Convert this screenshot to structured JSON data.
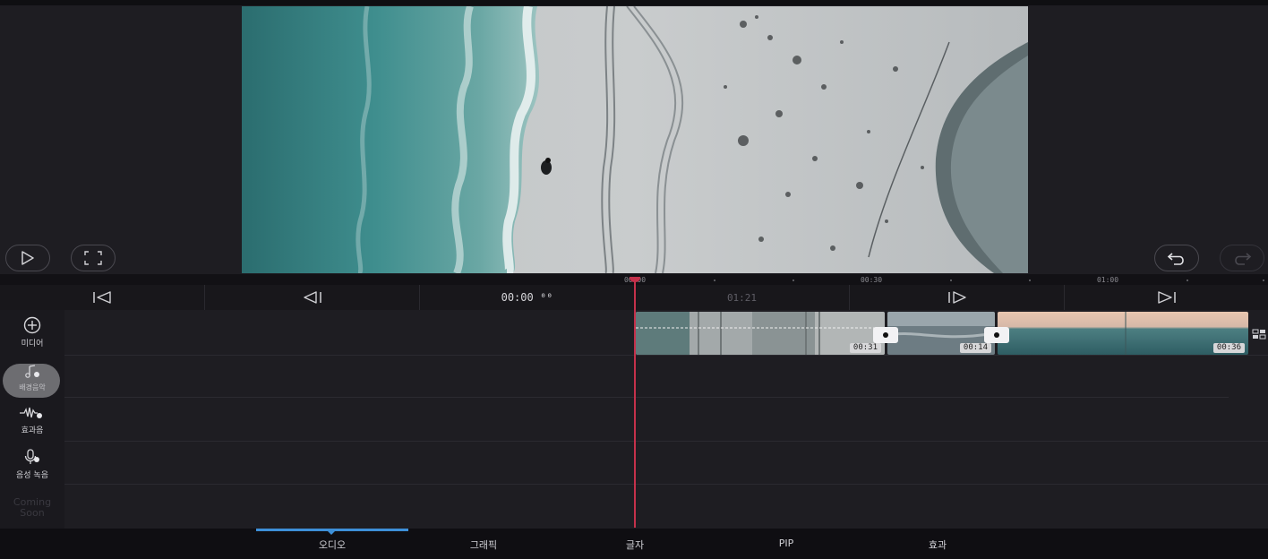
{
  "preview": {
    "play_icon": "play-icon",
    "fullscreen_icon": "fullscreen-icon",
    "undo_icon": "undo-icon",
    "redo_icon": "redo-icon"
  },
  "ruler": {
    "labels": [
      "00:00",
      "00:30",
      "01:00"
    ]
  },
  "transport": {
    "current_time": "00:00 ⁰⁰",
    "total_time": "01:21",
    "icons": [
      "skip-to-start-icon",
      "previous-frame-icon",
      "next-frame-icon",
      "skip-to-end-icon"
    ]
  },
  "sidebar": {
    "media": "미디어",
    "music": "배경음악",
    "sound_effect": "효과음",
    "voice_record": "음성 녹음",
    "coming_soon": "Coming Soon"
  },
  "clips": [
    {
      "duration": "00:31"
    },
    {
      "duration": "00:14"
    },
    {
      "duration": "00:36"
    }
  ],
  "tabs": {
    "audio": "오디오",
    "graphic": "그래픽",
    "text": "글자",
    "pip": "PIP",
    "effect": "효과"
  },
  "colors": {
    "playhead": "#c4314b",
    "tab_indicator": "#3d8fd8",
    "background": "#1e1d22"
  }
}
